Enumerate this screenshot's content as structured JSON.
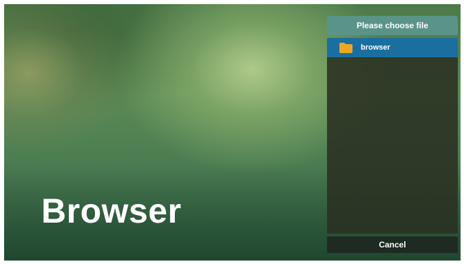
{
  "app": {
    "title": "Browser"
  },
  "dialog": {
    "title": "Please choose file",
    "items": [
      {
        "label": "browser",
        "icon": "folder-icon",
        "selected": true
      }
    ],
    "cancel_label": "Cancel"
  },
  "colors": {
    "header": "#5a9488",
    "selected_item": "#1a6fa0",
    "folder": "#f0a623",
    "list_background": "#2a3022",
    "cancel_background": "#1e2a22",
    "text": "#ffffff"
  }
}
